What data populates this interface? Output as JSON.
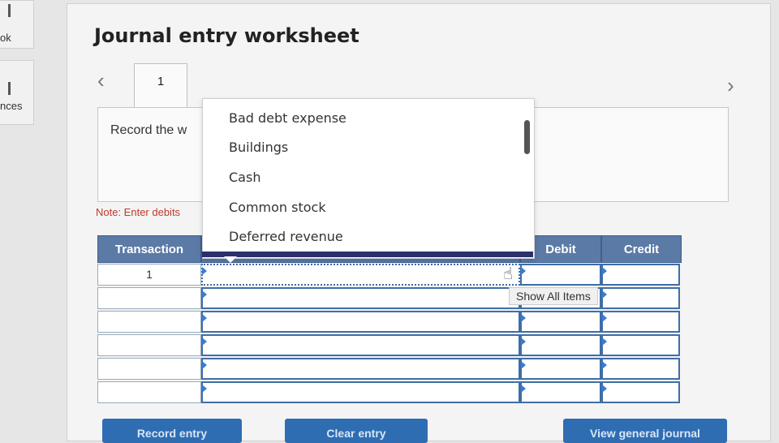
{
  "sidebar": {
    "items": [
      {
        "label": "ok"
      },
      {
        "label": "nces"
      }
    ]
  },
  "header": {
    "title": "Journal entry worksheet",
    "prev_icon": "chevron-left-icon",
    "next_icon": "chevron-right-icon"
  },
  "tabs": [
    {
      "label": "1"
    }
  ],
  "instructions": {
    "text": "Record the w"
  },
  "note": {
    "text": "Note: Enter debits"
  },
  "table": {
    "columns": [
      "Transaction",
      "",
      "Debit",
      "Credit"
    ],
    "rows": [
      {
        "transaction": "1"
      },
      {
        "transaction": ""
      },
      {
        "transaction": ""
      },
      {
        "transaction": ""
      },
      {
        "transaction": ""
      },
      {
        "transaction": ""
      }
    ]
  },
  "dropdown": {
    "options": [
      "Bad debt expense",
      "Buildings",
      "Cash",
      "Common stock",
      "Deferred revenue"
    ]
  },
  "tooltip": {
    "text": "Show All Items"
  },
  "buttons": {
    "record_entry": "Record entry",
    "clear_entry": "Clear entry",
    "view_general_journal": "View general journal"
  },
  "colors": {
    "header_bg": "#5b7aa6",
    "cell_border": "#3f6ea6",
    "button_bg": "#2f6db3",
    "note_text": "#c0392b"
  }
}
